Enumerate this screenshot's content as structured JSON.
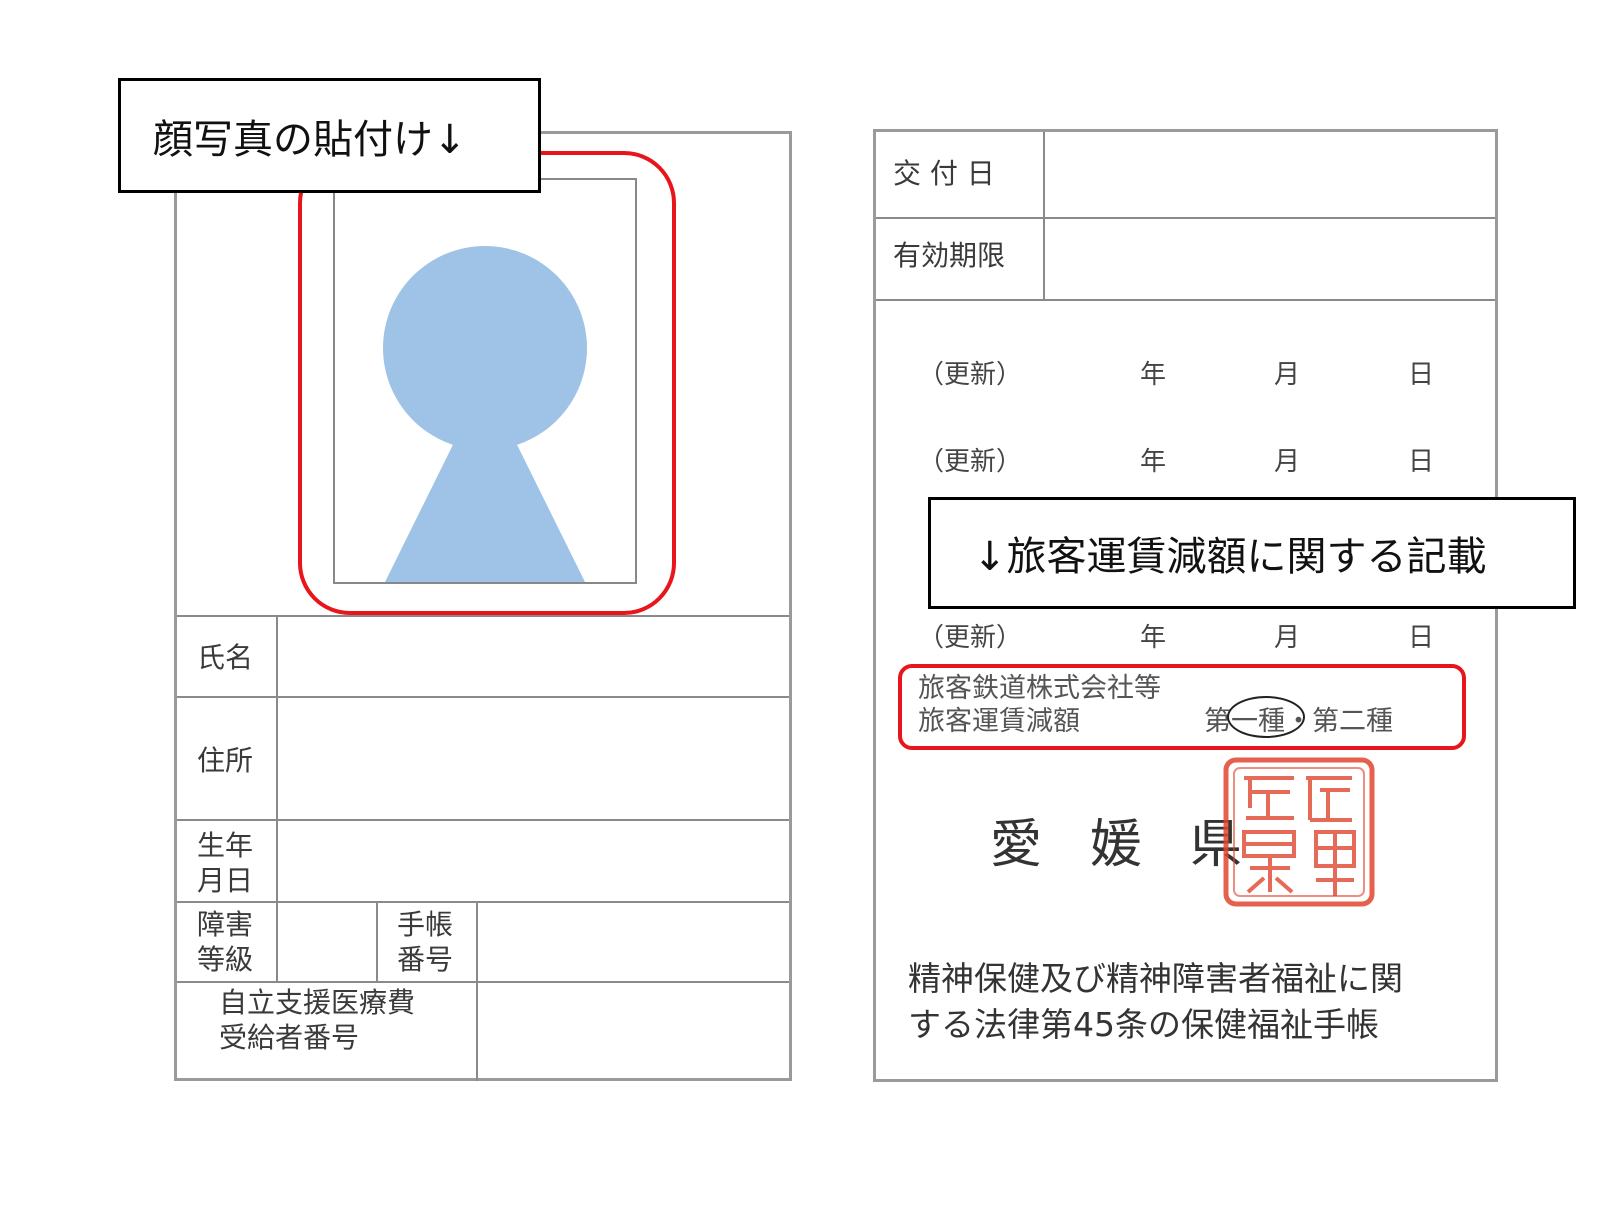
{
  "left_card": {
    "labels": {
      "name": "氏名",
      "address": "住所",
      "birth_line1": "生年",
      "birth_line2": "月日",
      "grade_line1": "障害",
      "grade_line2": "等級",
      "book_line1": "手帳",
      "book_line2": "番号",
      "medical_line1": "自立支援医療費",
      "medical_line2": "受給者番号"
    }
  },
  "callouts": {
    "photo": "顔写真の貼付け↓",
    "fare": "↓旅客運賃減額に関する記載"
  },
  "right_card": {
    "issue_date_label": "交 付 日",
    "validity_label": "有効期限",
    "renewal": {
      "label": "（更新）",
      "year": "年",
      "month": "月",
      "day": "日"
    },
    "fare_line1": "旅客鉄道株式会社等",
    "fare_line2": "旅客運賃減額",
    "fare_classes": "第一種・第二種",
    "prefecture": "愛媛県",
    "footer_line1": "精神保健及び精神障害者福祉に関",
    "footer_line2": "する法律第45条の保健福祉手帳"
  },
  "colors": {
    "highlight_red": "#e8151b",
    "silhouette_blue": "#9fc3e6",
    "seal_red": "#e0452f"
  },
  "icons": {
    "photo_placeholder": "person-silhouette-icon",
    "seal": "prefectural-seal-stamp"
  }
}
